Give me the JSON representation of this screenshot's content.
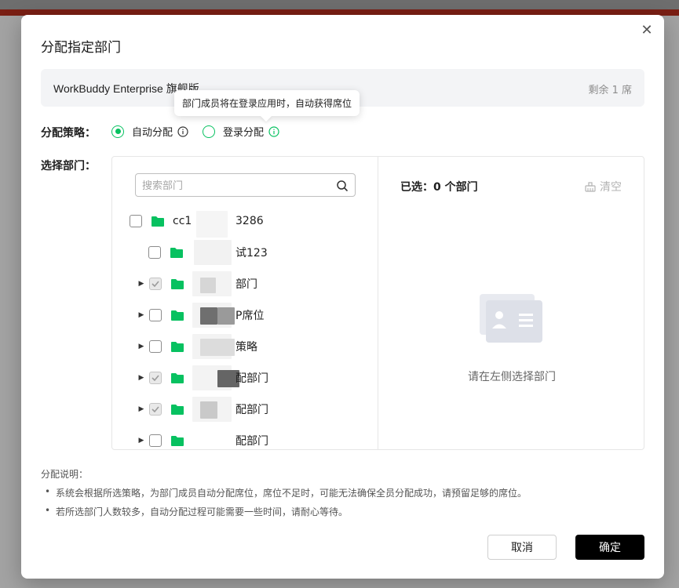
{
  "dialog": {
    "title": "分配指定部门",
    "close_icon": "close-icon"
  },
  "plan": {
    "name": "WorkBuddy Enterprise 旗舰版",
    "remaining": "剩余 1 席"
  },
  "tooltip": {
    "text": "部门成员将在登录应用时，自动获得席位"
  },
  "strategy": {
    "label": "分配策略：",
    "options": [
      {
        "label": "自动分配",
        "selected": true
      },
      {
        "label": "登录分配",
        "selected": false
      }
    ]
  },
  "department": {
    "label": "选择部门：",
    "search_placeholder": "搜索部门",
    "tree": [
      {
        "label_visible": "cc1",
        "label_suffix": "3286",
        "checked": false,
        "expandable": false,
        "level": 0
      },
      {
        "label_visible": "",
        "label_suffix": "试123",
        "checked": false,
        "expandable": false,
        "level": 1
      },
      {
        "label_visible": "",
        "label_suffix": "部门",
        "checked": true,
        "expandable": true,
        "level": 1
      },
      {
        "label_visible": "",
        "label_suffix": "P席位",
        "checked": false,
        "expandable": true,
        "level": 1
      },
      {
        "label_visible": "",
        "label_suffix": "策略",
        "checked": false,
        "expandable": true,
        "level": 1
      },
      {
        "label_visible": "",
        "label_suffix": "配部门",
        "checked": true,
        "expandable": true,
        "level": 1
      },
      {
        "label_visible": "",
        "label_suffix": "配部门",
        "checked": true,
        "expandable": true,
        "level": 1
      },
      {
        "label_visible": "",
        "label_suffix": "配部门",
        "checked": false,
        "expandable": true,
        "level": 1
      }
    ]
  },
  "selected": {
    "count_label": "已选：0 个部门",
    "clear_label": "清空",
    "empty_text": "请在左侧选择部门"
  },
  "notes": {
    "title": "分配说明：",
    "items": [
      "系统会根据所选策略，为部门成员自动分配席位，席位不足时，可能无法确保全员分配成功，请预留足够的席位。",
      "若所选部门人数较多，自动分配过程可能需要一些时间，请耐心等待。"
    ]
  },
  "buttons": {
    "cancel": "取消",
    "ok": "确定"
  },
  "colors": {
    "accent": "#07c160",
    "primary_button": "#000000"
  }
}
